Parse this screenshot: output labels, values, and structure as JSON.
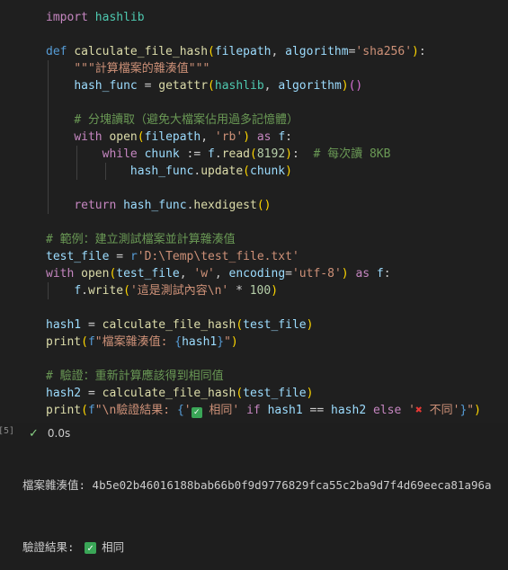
{
  "code_lines": [
    [
      [
        "kw",
        "import"
      ],
      [
        "pl",
        " "
      ],
      [
        "cls",
        "hashlib"
      ]
    ],
    [],
    [
      [
        "kwb",
        "def"
      ],
      [
        "pl",
        " "
      ],
      [
        "fn",
        "calculate_file_hash"
      ],
      [
        "br1",
        "("
      ],
      [
        "nm",
        "filepath"
      ],
      [
        "pl",
        ", "
      ],
      [
        "nm",
        "algorithm"
      ],
      [
        "pl",
        "="
      ],
      [
        "st",
        "'sha256'"
      ],
      [
        "br1",
        ")"
      ],
      [
        "pl",
        ":"
      ]
    ],
    [
      [
        "pl",
        "    "
      ],
      [
        "st",
        "\"\"\"計算檔案的雜湊值\"\"\""
      ]
    ],
    [
      [
        "pl",
        "    "
      ],
      [
        "nm",
        "hash_func"
      ],
      [
        "pl",
        " = "
      ],
      [
        "fn",
        "getattr"
      ],
      [
        "br1",
        "("
      ],
      [
        "cls",
        "hashlib"
      ],
      [
        "pl",
        ", "
      ],
      [
        "nm",
        "algorithm"
      ],
      [
        "br1",
        ")"
      ],
      [
        "br2",
        "()"
      ]
    ],
    [],
    [
      [
        "pl",
        "    "
      ],
      [
        "cm",
        "# 分塊讀取（避免大檔案佔用過多記憶體）"
      ]
    ],
    [
      [
        "pl",
        "    "
      ],
      [
        "kw",
        "with"
      ],
      [
        "pl",
        " "
      ],
      [
        "fn",
        "open"
      ],
      [
        "br1",
        "("
      ],
      [
        "nm",
        "filepath"
      ],
      [
        "pl",
        ", "
      ],
      [
        "st",
        "'rb'"
      ],
      [
        "br1",
        ")"
      ],
      [
        "pl",
        " "
      ],
      [
        "kw",
        "as"
      ],
      [
        "pl",
        " "
      ],
      [
        "nm",
        "f"
      ],
      [
        "pl",
        ":"
      ]
    ],
    [
      [
        "pl",
        "        "
      ],
      [
        "kw",
        "while"
      ],
      [
        "pl",
        " "
      ],
      [
        "nm",
        "chunk"
      ],
      [
        "pl",
        " := "
      ],
      [
        "nm",
        "f"
      ],
      [
        "pl",
        "."
      ],
      [
        "fn",
        "read"
      ],
      [
        "br1",
        "("
      ],
      [
        "num",
        "8192"
      ],
      [
        "br1",
        ")"
      ],
      [
        "pl",
        ":  "
      ],
      [
        "cm",
        "# 每次讀 8KB"
      ]
    ],
    [
      [
        "pl",
        "            "
      ],
      [
        "nm",
        "hash_func"
      ],
      [
        "pl",
        "."
      ],
      [
        "fn",
        "update"
      ],
      [
        "br1",
        "("
      ],
      [
        "nm",
        "chunk"
      ],
      [
        "br1",
        ")"
      ]
    ],
    [],
    [
      [
        "pl",
        "    "
      ],
      [
        "kw",
        "return"
      ],
      [
        "pl",
        " "
      ],
      [
        "nm",
        "hash_func"
      ],
      [
        "pl",
        "."
      ],
      [
        "fn",
        "hexdigest"
      ],
      [
        "br1",
        "()"
      ]
    ],
    [],
    [
      [
        "cm",
        "# 範例：建立測試檔案並計算雜湊值"
      ]
    ],
    [
      [
        "nm",
        "test_file"
      ],
      [
        "pl",
        " = "
      ],
      [
        "kwb",
        "r"
      ],
      [
        "st",
        "'D:\\Temp\\test_file.txt'"
      ]
    ],
    [
      [
        "kw",
        "with"
      ],
      [
        "pl",
        " "
      ],
      [
        "fn",
        "open"
      ],
      [
        "br1",
        "("
      ],
      [
        "nm",
        "test_file"
      ],
      [
        "pl",
        ", "
      ],
      [
        "st",
        "'w'"
      ],
      [
        "pl",
        ", "
      ],
      [
        "nm",
        "encoding"
      ],
      [
        "pl",
        "="
      ],
      [
        "st",
        "'utf-8'"
      ],
      [
        "br1",
        ")"
      ],
      [
        "pl",
        " "
      ],
      [
        "kw",
        "as"
      ],
      [
        "pl",
        " "
      ],
      [
        "nm",
        "f"
      ],
      [
        "pl",
        ":"
      ]
    ],
    [
      [
        "pl",
        "    "
      ],
      [
        "nm",
        "f"
      ],
      [
        "pl",
        "."
      ],
      [
        "fn",
        "write"
      ],
      [
        "br1",
        "("
      ],
      [
        "st",
        "'這是測試內容\\n'"
      ],
      [
        "pl",
        " * "
      ],
      [
        "num",
        "100"
      ],
      [
        "br1",
        ")"
      ]
    ],
    [],
    [
      [
        "nm",
        "hash1"
      ],
      [
        "pl",
        " = "
      ],
      [
        "fn",
        "calculate_file_hash"
      ],
      [
        "br1",
        "("
      ],
      [
        "nm",
        "test_file"
      ],
      [
        "br1",
        ")"
      ]
    ],
    [
      [
        "fn",
        "print"
      ],
      [
        "br1",
        "("
      ],
      [
        "kwb",
        "f"
      ],
      [
        "st",
        "\"檔案雜湊值: "
      ],
      [
        "kwb",
        "{"
      ],
      [
        "nm",
        "hash1"
      ],
      [
        "kwb",
        "}"
      ],
      [
        "st",
        "\""
      ],
      [
        "br1",
        ")"
      ]
    ],
    [],
    [
      [
        "cm",
        "# 驗證：重新計算應該得到相同值"
      ]
    ],
    [
      [
        "nm",
        "hash2"
      ],
      [
        "pl",
        " = "
      ],
      [
        "fn",
        "calculate_file_hash"
      ],
      [
        "br1",
        "("
      ],
      [
        "nm",
        "test_file"
      ],
      [
        "br1",
        ")"
      ]
    ],
    [
      [
        "fn",
        "print"
      ],
      [
        "br1",
        "("
      ],
      [
        "kwb",
        "f"
      ],
      [
        "st",
        "\"\\n驗證結果: "
      ],
      [
        "kwb",
        "{"
      ],
      [
        "st",
        "'"
      ],
      [
        "box",
        "✓"
      ],
      [
        "st",
        " 相同'"
      ],
      [
        "pl",
        " "
      ],
      [
        "kw",
        "if"
      ],
      [
        "pl",
        " "
      ],
      [
        "nm",
        "hash1"
      ],
      [
        "pl",
        " == "
      ],
      [
        "nm",
        "hash2"
      ],
      [
        "pl",
        " "
      ],
      [
        "kw",
        "else"
      ],
      [
        "pl",
        " "
      ],
      [
        "st",
        "'"
      ],
      [
        "cross",
        "✖"
      ],
      [
        "st",
        " 不同'"
      ],
      [
        "kwb",
        "}"
      ],
      [
        "st",
        "\""
      ],
      [
        "br1",
        ")"
      ]
    ]
  ],
  "execution_counter": "[5]",
  "execution_time": "0.0s",
  "output": {
    "line1": "檔案雜湊值: 4b5e02b46016188bab66b0f9d9776829fca55c2ba9d7f4d69eeca81a96a",
    "line2_label": "驗證結果: ",
    "line2_value": "相同"
  },
  "colors": {
    "background": "#1f1f1f",
    "success": "#89d185",
    "checkbox": "#3aa657"
  }
}
